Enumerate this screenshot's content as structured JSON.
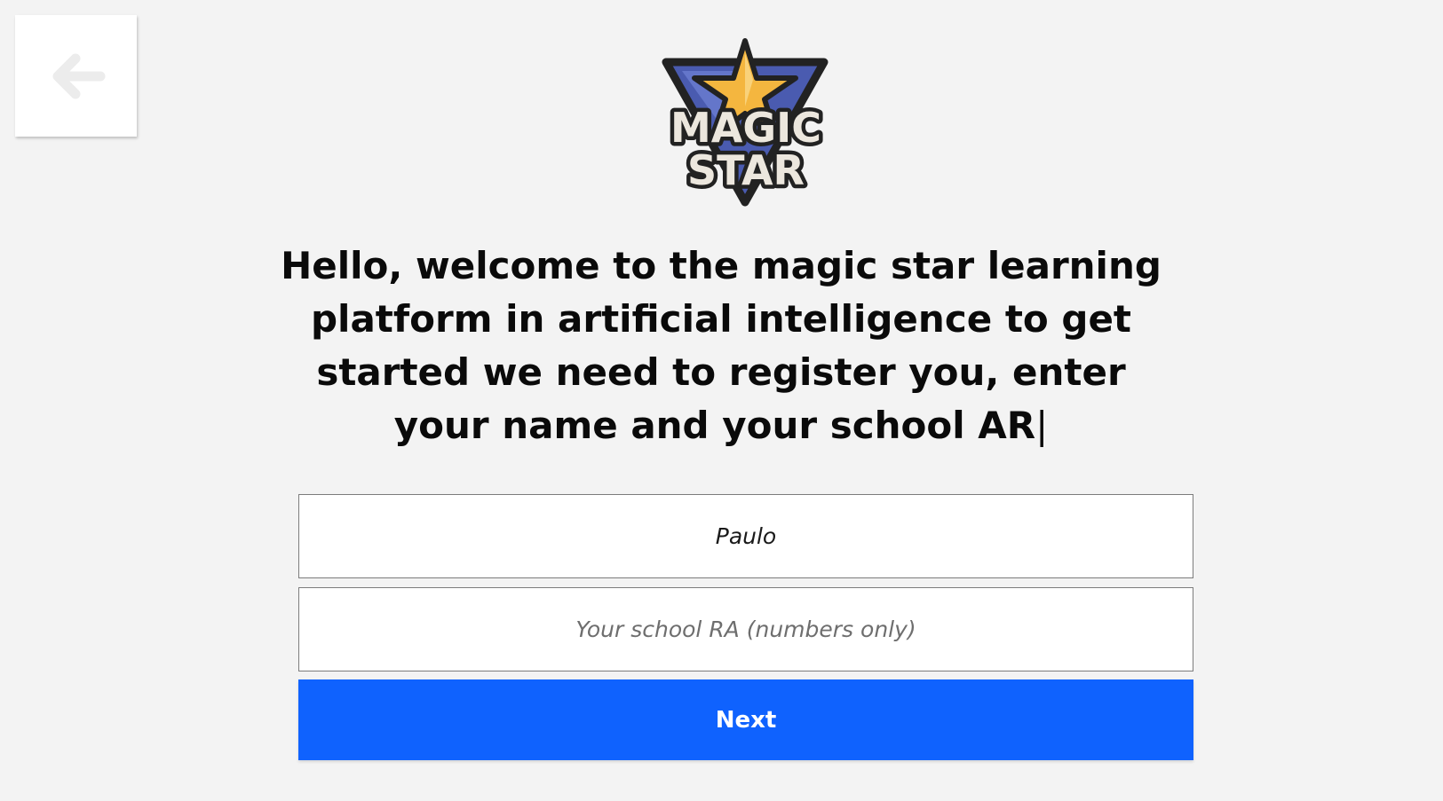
{
  "back_button": {
    "icon": "arrow-left-icon",
    "icon_color": "#ececec"
  },
  "logo": {
    "icon": "magic-star-logo",
    "line1": "MAGIC",
    "line2": "STAR",
    "colors": {
      "star": "#f4b63f",
      "triangle": "#4a5bb0",
      "outline": "#222222",
      "text": "#ece7de"
    }
  },
  "welcome": {
    "text": "Hello, welcome to the magic star learning platform in artificial intelligence to get started we need to register you, enter your name and your school AR",
    "caret": "|"
  },
  "form": {
    "name_value": "Paulo",
    "ra_placeholder": "Your school RA (numbers only)",
    "next_label": "Next"
  },
  "colors": {
    "background": "#f3f3f3",
    "accent": "#0f62fe"
  }
}
